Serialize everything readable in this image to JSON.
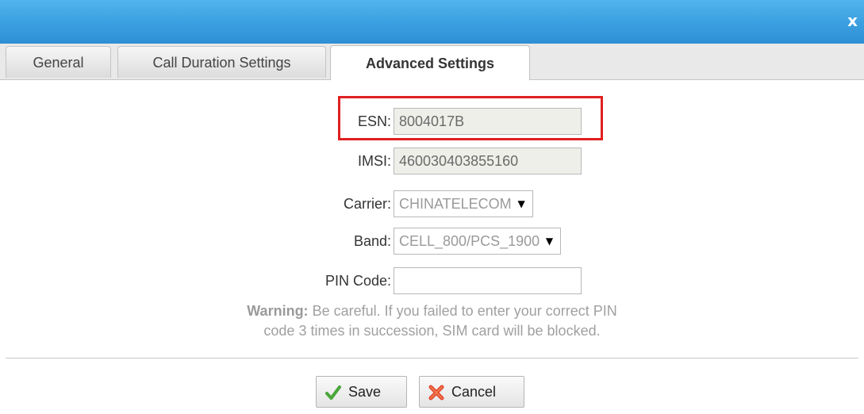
{
  "window": {
    "close_label": "x"
  },
  "tabs": [
    {
      "label": "General"
    },
    {
      "label": "Call Duration Settings"
    },
    {
      "label": "Advanced Settings",
      "active": true
    }
  ],
  "form": {
    "esn": {
      "label": "ESN:",
      "value": "8004017B"
    },
    "imsi": {
      "label": "IMSI:",
      "value": "460030403855160"
    },
    "carrier": {
      "label": "Carrier:",
      "value": "CHINATELECOM"
    },
    "band": {
      "label": "Band:",
      "value": "CELL_800/PCS_1900"
    },
    "pin": {
      "label": "PIN Code:",
      "value": ""
    },
    "warning": {
      "prefix": "Warning:",
      "line1": "Be careful. If you failed to enter your correct PIN",
      "line2": "code 3 times in succession, SIM card will be blocked."
    }
  },
  "buttons": {
    "save_label": "Save",
    "cancel_label": "Cancel"
  },
  "colors": {
    "titlebar": "#3a9fe0",
    "highlight": "#e02020",
    "warning_text": "#a0a0a0"
  },
  "icons": {
    "save": "check-icon",
    "cancel": "cross-icon",
    "dropdown": "dropdown-arrow-icon"
  }
}
